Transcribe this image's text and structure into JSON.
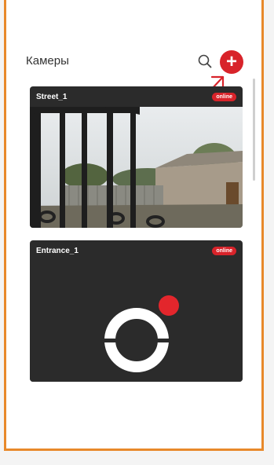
{
  "header": {
    "title": "Камеры"
  },
  "cameras": [
    {
      "name": "Street_1",
      "status": "online"
    },
    {
      "name": "Entrance_1",
      "status": "online"
    }
  ],
  "colors": {
    "accent": "#d8232a",
    "frame": "#e8892b"
  }
}
